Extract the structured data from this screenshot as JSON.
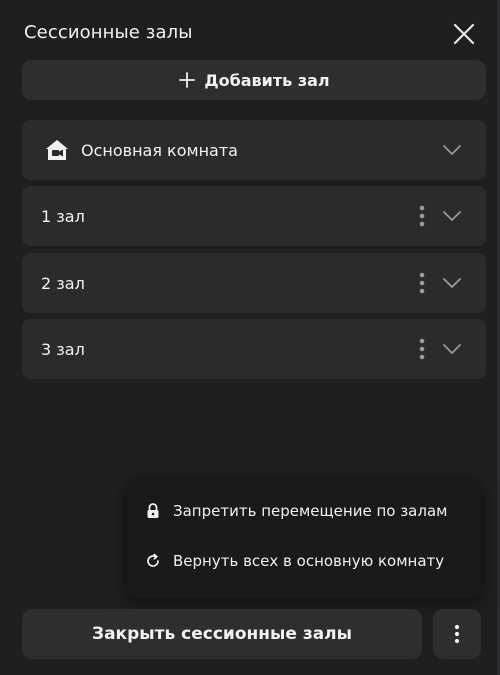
{
  "header": {
    "title": "Сессионные залы",
    "close_icon": "close-icon"
  },
  "add_button": {
    "label": "Добавить зал",
    "icon": "plus-icon"
  },
  "main_room": {
    "label": "Основная комната",
    "icon": "home-icon"
  },
  "rooms": [
    {
      "label": "1 зал"
    },
    {
      "label": "2 зал"
    },
    {
      "label": "3 зал"
    }
  ],
  "popup_menu": {
    "items": [
      {
        "label": "Запретить перемещение по залам",
        "icon": "lock-icon"
      },
      {
        "label": "Вернуть всех в основную комнату",
        "icon": "refresh-icon"
      }
    ]
  },
  "footer": {
    "close_rooms_label": "Закрыть сессионные залы",
    "more_icon": "more-vertical-icon"
  },
  "colors": {
    "background": "#1f1f22",
    "card": "#2b2b2e",
    "button": "#2e2e31",
    "popup": "#1a1a1c",
    "text": "#f2f2f2",
    "icon": "#9a9a9e"
  }
}
